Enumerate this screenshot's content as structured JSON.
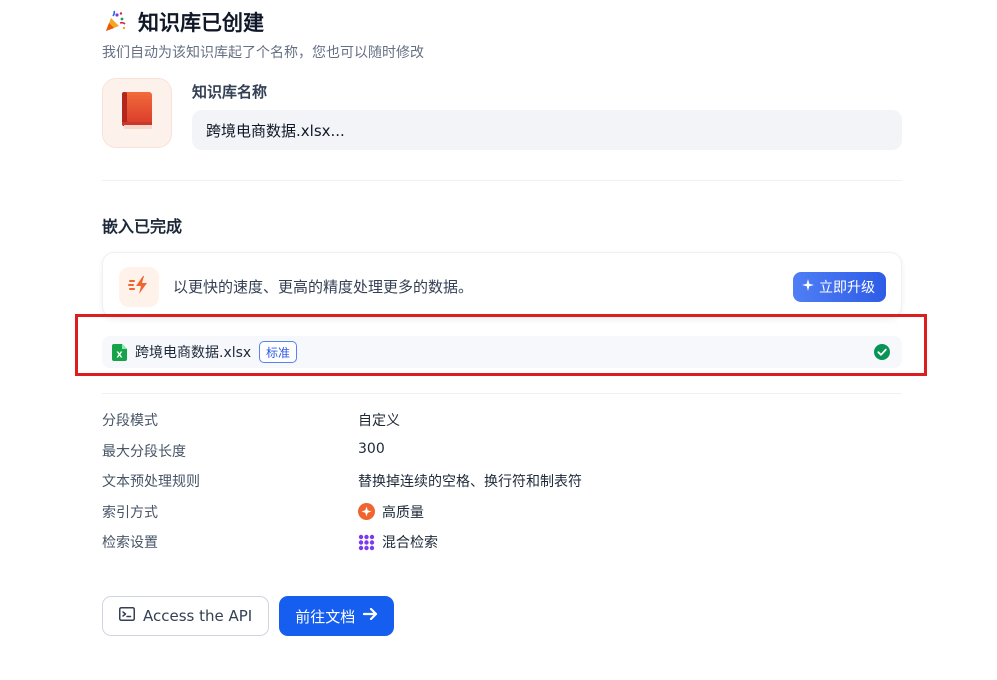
{
  "header": {
    "icon": "party-popper-icon",
    "title": "知识库已创建",
    "subtitle": "我们自动为该知识库起了个名称，您也可以随时修改"
  },
  "knowledge_base": {
    "icon": "book-icon",
    "name_label": "知识库名称",
    "name_value": "跨境电商数据.xlsx..."
  },
  "embedding": {
    "section_title": "嵌入已完成",
    "upgrade_card": {
      "icon": "lightning-icon",
      "text": "以更快的速度、更高的精度处理更多的数据。",
      "button_label": "立即升级",
      "button_icon": "sparkle-icon"
    },
    "file": {
      "icon": "excel-file-icon",
      "name": "跨境电商数据.xlsx",
      "badge": "标准",
      "status_icon": "check-circle-icon",
      "status_color": "#079455"
    }
  },
  "params": [
    {
      "label": "分段模式",
      "value": "自定义",
      "icon": null
    },
    {
      "label": "最大分段长度",
      "value": "300",
      "icon": null
    },
    {
      "label": "文本预处理规则",
      "value": "替换掉连续的空格、换行符和制表符",
      "icon": null
    },
    {
      "label": "索引方式",
      "value": "高质量",
      "icon": "high-quality-icon"
    },
    {
      "label": "检索设置",
      "value": "混合检索",
      "icon": "hybrid-search-icon"
    }
  ],
  "actions": {
    "api_label": "Access the API",
    "api_icon": "terminal-icon",
    "docs_label": "前往文档",
    "docs_icon": "arrow-right-icon"
  },
  "colors": {
    "primary": "#155eef",
    "highlight_border": "#db1f1f",
    "upgrade_gradient_start": "#4f7ef5",
    "upgrade_gradient_end": "#2e5ce6",
    "accent_orange": "#f0652f"
  }
}
